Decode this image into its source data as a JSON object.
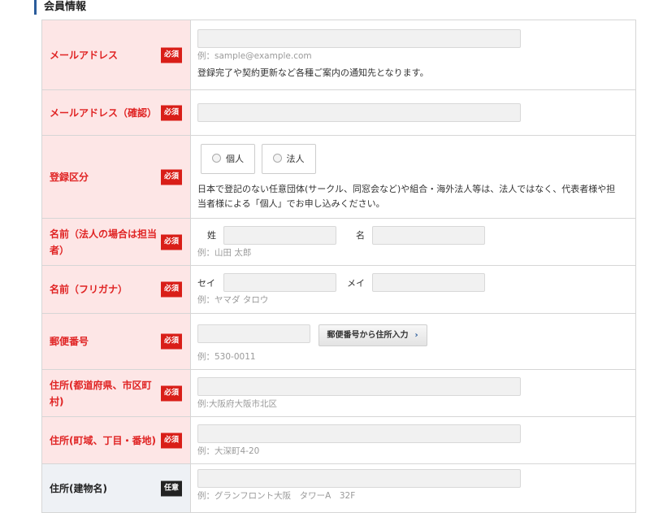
{
  "section_title": "会員情報",
  "badges": {
    "required": "必須",
    "optional": "任意"
  },
  "rows": {
    "email": {
      "label": "メールアドレス",
      "placeholder": "",
      "hint": "例：sample@example.com",
      "note": "登録完了や契約更新など各種ご案内の通知先となります。"
    },
    "email_confirm": {
      "label": "メールアドレス（確認）"
    },
    "registration_type": {
      "label": "登録区分",
      "options": [
        "個人",
        "法人"
      ],
      "note": "日本で登記のない任意団体(サークル、同窓会など)や組合・海外法人等は、法人ではなく、代表者様や担当者様による「個人」でお申し込みください。"
    },
    "name": {
      "label": "名前（法人の場合は担当者）",
      "last_label": "姓",
      "first_label": "名",
      "hint": "例：山田 太郎"
    },
    "name_kana": {
      "label": "名前（フリガナ）",
      "last_label": "セイ",
      "first_label": "メイ",
      "hint": "例：ヤマダ タロウ"
    },
    "postal_code": {
      "label": "郵便番号",
      "button_label": "郵便番号から住所入力",
      "hint": "例：530-0011"
    },
    "address_pref": {
      "label": "住所(都道府県、市区町村)",
      "hint": "例:大阪府大阪市北区"
    },
    "address_town": {
      "label": "住所(町域、丁目・番地)",
      "hint": "例：大深町4-20"
    },
    "address_building": {
      "label": "住所(建物名)",
      "hint": "例：グランフロント大阪　タワーA　32F"
    }
  }
}
